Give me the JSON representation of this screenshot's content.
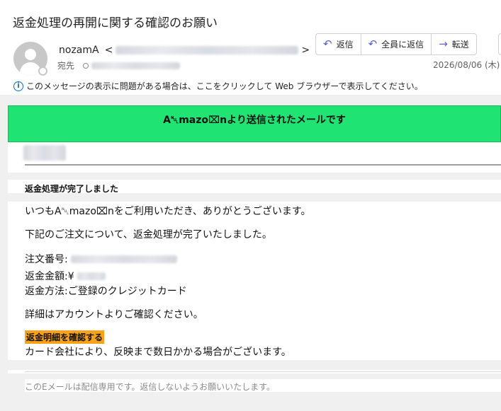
{
  "email": {
    "subject": "返金処理の再開に関する確認のお願い",
    "sender_name": "nozamA",
    "sender_open": "<",
    "sender_close": ">",
    "to_label": "宛先",
    "date": "2026/08/06 (木)",
    "info_message": "このメッセージの表示に問題がある場合は、ここをクリックして Web ブラウザーで表示してください。"
  },
  "actions": [
    {
      "label": "返信",
      "icon": "reply-icon",
      "glyph": "↶"
    },
    {
      "label": "全員に返信",
      "icon": "reply-all-icon",
      "glyph": "↶"
    },
    {
      "label": "転送",
      "icon": "forward-icon",
      "glyph": "→"
    }
  ],
  "message": {
    "banner": "A␀mazo⌧nより送信されたメールです",
    "section_title": "返金処理が完了しました",
    "greeting": "いつもA␀mazo⌧nをご利用いただき、ありがとうございます。",
    "intro": "下記のご注文について、返金処理が完了いたしました。",
    "order_label": "注文番号:",
    "amount_label": "返金金額:¥",
    "method_line": "返金方法:ご登録のクレジットカード",
    "details_line": "詳細はアカウントよりご確認ください。",
    "cta_label": "返金明細を確認する",
    "note_line": "カード会社により、反映まで数日かかる場合がございます。",
    "footer": "このEメールは配信専用です。返信しないようお願いいたします。"
  },
  "colors": {
    "banner": "#1fe372",
    "cta": "#f7a21b",
    "accent": "#5b5fc7",
    "info": "#0f6cbd"
  }
}
